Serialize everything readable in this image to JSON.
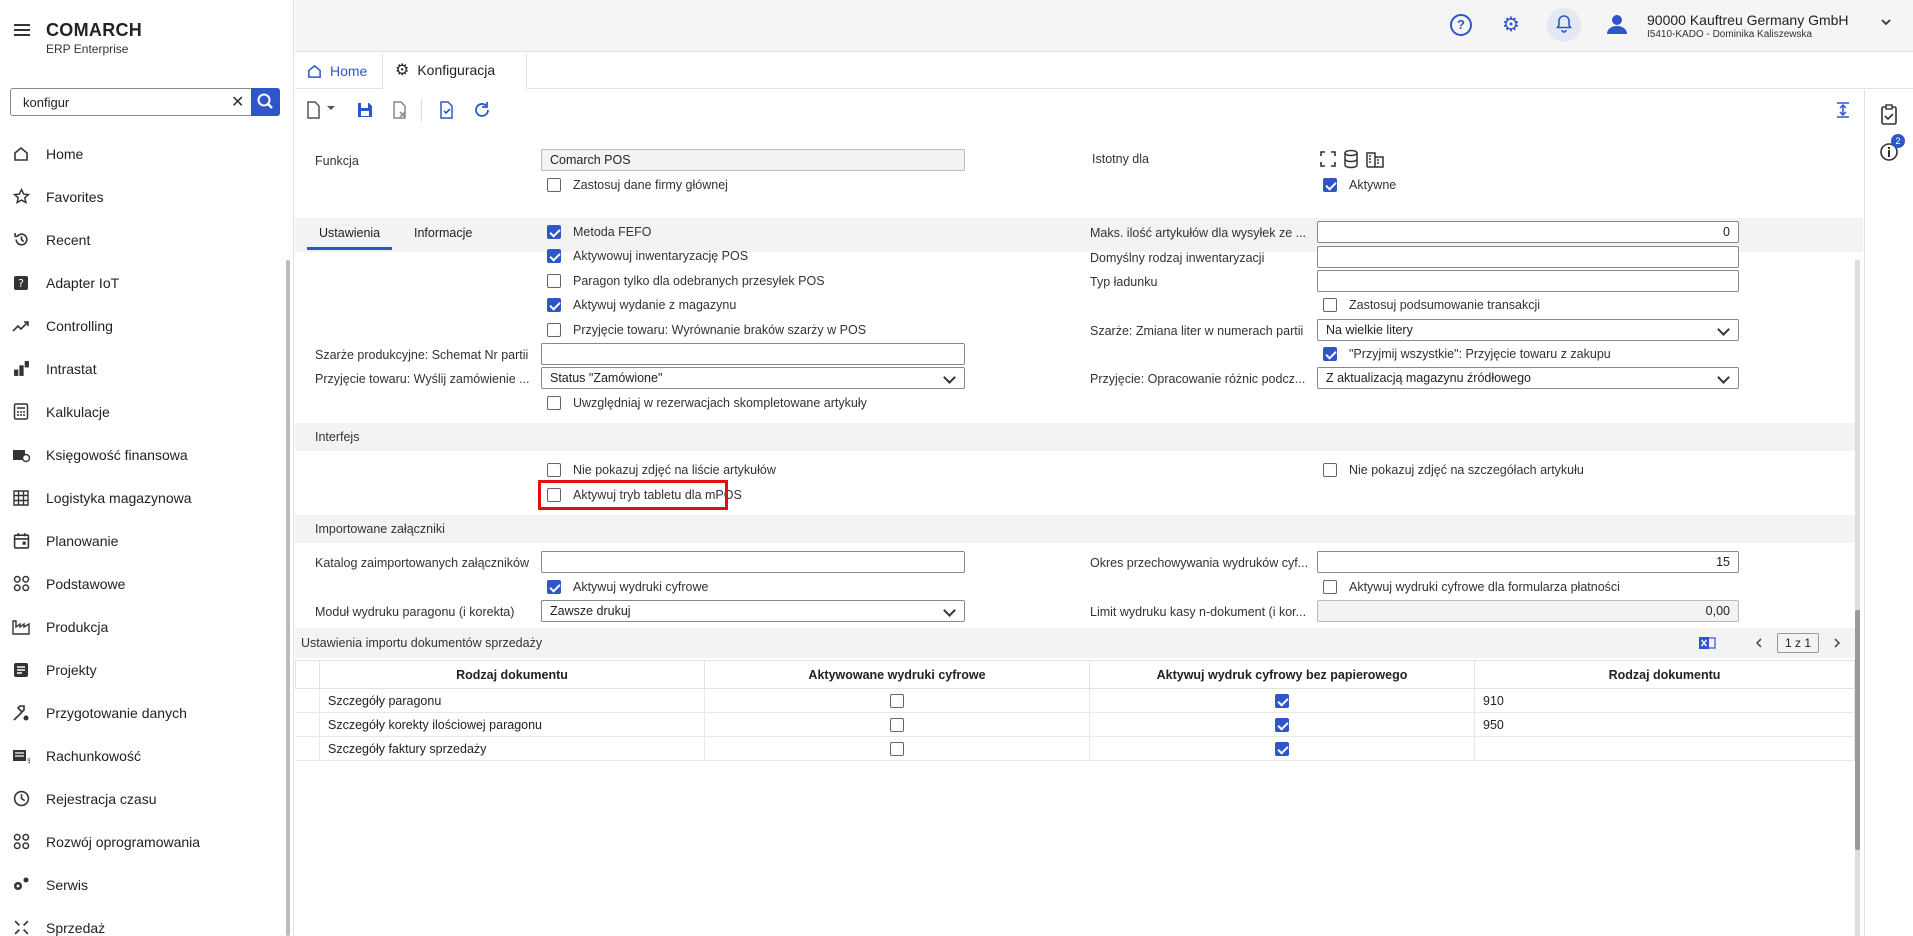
{
  "app": {
    "brand": "COMARCH",
    "brand_sub": "ERP Enterprise"
  },
  "search": {
    "value": "konfigur"
  },
  "sidebar": {
    "items": [
      {
        "label": "Home",
        "icon": "home-icon"
      },
      {
        "label": "Favorites",
        "icon": "star-icon"
      },
      {
        "label": "Recent",
        "icon": "history-icon"
      },
      {
        "label": "Adapter IoT",
        "icon": "help-box-icon"
      },
      {
        "label": "Controlling",
        "icon": "trend-icon"
      },
      {
        "label": "Intrastat",
        "icon": "intrastat-icon"
      },
      {
        "label": "Kalkulacje",
        "icon": "calculator-icon"
      },
      {
        "label": "Księgowość finansowa",
        "icon": "accounting-icon"
      },
      {
        "label": "Logistyka magazynowa",
        "icon": "grid-icon"
      },
      {
        "label": "Planowanie",
        "icon": "calendar-icon"
      },
      {
        "label": "Podstawowe",
        "icon": "basic-icon"
      },
      {
        "label": "Produkcja",
        "icon": "factory-icon"
      },
      {
        "label": "Projekty",
        "icon": "projects-icon"
      },
      {
        "label": "Przygotowanie danych",
        "icon": "data-prep-icon"
      },
      {
        "label": "Rachunkowość",
        "icon": "ledger-icon"
      },
      {
        "label": "Rejestracja czasu",
        "icon": "clock-icon"
      },
      {
        "label": "Rozwój oprogramowania",
        "icon": "dev-icon"
      },
      {
        "label": "Serwis",
        "icon": "service-icon"
      },
      {
        "label": "Sprzedaż",
        "icon": "sales-icon"
      }
    ]
  },
  "topbar": {
    "help": "?",
    "company": "90000  Kauftreu Germany GmbH",
    "user": "I5410-KADO - Dominika Kaliszewska",
    "info_badge": "2"
  },
  "tabs": {
    "home": "Home",
    "config": "Konfiguracja"
  },
  "header": {
    "funkcja_label": "Funkcja",
    "funkcja_value": "Comarch POS",
    "zastosuj_dane": "Zastosuj dane firmy głównej",
    "istotny_label": "Istotny dla",
    "aktywne": "Aktywne"
  },
  "subtabs": {
    "ustawienia": "Ustawienia",
    "informacje": "Informacje"
  },
  "settings": {
    "metoda_fefo": "Metoda FEFO",
    "aktywowuj_inw": "Aktywowuj inwentaryzację POS",
    "paragon_tylko": "Paragon tylko dla odebranych przesyłek POS",
    "aktywuj_wydanie": "Aktywuj wydanie z magazynu",
    "przyjecie_braki": "Przyjęcie towaru: Wyrównanie braków szarży w POS",
    "maks_label": "Maks. ilość artykułów dla wysyłek ze ...",
    "maks_value": "0",
    "domyslny_label": "Domyślny rodzaj inwentaryzacji",
    "typ_label": "Typ ładunku",
    "zastosuj_podsum": "Zastosuj podsumowanie transakcji",
    "szarze_zmiana_label": "Szarże: Zmiana liter w numerach partii",
    "szarze_zmiana_value": "Na wielkie litery",
    "szarze_prod_label": "Szarże produkcyjne: Schemat Nr partii",
    "przyjmij_wszystkie": "\"Przyjmij wszystkie\": Przyjęcie towaru z zakupu",
    "wyslij_label": "Przyjęcie towaru: Wyślij zamówienie ...",
    "wyslij_value": "Status \"Zamówione\"",
    "opracowanie_label": "Przyjęcie: Opracowanie różnic podcz...",
    "opracowanie_value": "Z aktualizacją magazynu źródłowego",
    "uwzgledniaj": "Uwzględniaj w rezerwacjach skompletowane artykuły"
  },
  "interfejs": {
    "title": "Interfejs",
    "nie_pokazuj_lista": "Nie pokazuj zdjęć na liście artykułów",
    "nie_pokazuj_szcz": "Nie pokazuj zdjęć na szczegółach artykułu",
    "tryb_tabletu": "Aktywuj tryb tabletu dla mPOS"
  },
  "zalaczniki": {
    "title": "Importowane załączniki",
    "katalog_label": "Katalog zaimportowanych załączników",
    "okres_label": "Okres przechowywania wydruków cyf...",
    "okres_value": "15",
    "aktywuj_wydruki": "Aktywuj wydruki cyfrowe",
    "aktywuj_wydruki_form": "Aktywuj wydruki cyfrowe dla formularza płatności",
    "modul_label": "Moduł wydruku paragonu (i korekta)",
    "modul_value": "Zawsze drukuj",
    "limit_label": "Limit wydruku kasy n-dokument (i kor...",
    "limit_value": "0,00"
  },
  "grid": {
    "title": "Ustawienia importu dokumentów sprzedaży",
    "pager": "1 z 1",
    "columns": [
      "Rodzaj dokumentu",
      "Aktywowane wydruki cyfrowe",
      "Aktywuj wydruk cyfrowy bez papierowego",
      "Rodzaj dokumentu"
    ],
    "rows": [
      {
        "name": "Szczegóły paragonu",
        "digital": false,
        "paperless": true,
        "code": "910"
      },
      {
        "name": "Szczegóły korekty ilościowej paragonu",
        "digital": false,
        "paperless": true,
        "code": "950"
      },
      {
        "name": "Szczegóły faktury sprzedaży",
        "digital": false,
        "paperless": true,
        "code": ""
      }
    ]
  },
  "colors": {
    "accent": "#2e56c8",
    "highlight": "#e01010"
  }
}
